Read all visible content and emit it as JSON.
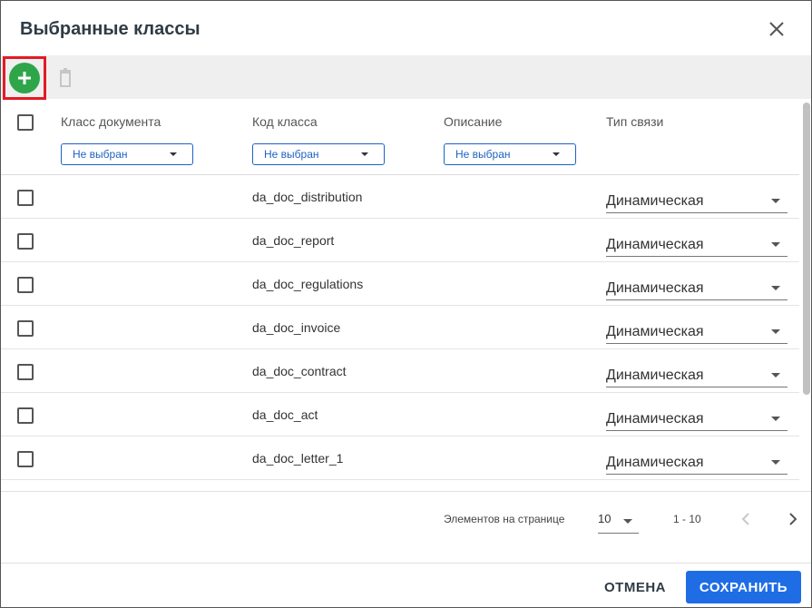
{
  "dialog": {
    "title": "Выбранные классы"
  },
  "table": {
    "columns": [
      {
        "label": "Класс документа",
        "filter": "Не выбран"
      },
      {
        "label": "Код класса",
        "filter": "Не выбран"
      },
      {
        "label": "Описание",
        "filter": "Не выбран"
      },
      {
        "label": "Тип связи"
      }
    ],
    "rows": [
      {
        "doc_class": "",
        "code": "da_doc_distribution",
        "description": "",
        "link_type": "Динамическая"
      },
      {
        "doc_class": "",
        "code": "da_doc_report",
        "description": "",
        "link_type": "Динамическая"
      },
      {
        "doc_class": "",
        "code": "da_doc_regulations",
        "description": "",
        "link_type": "Динамическая"
      },
      {
        "doc_class": "",
        "code": "da_doc_invoice",
        "description": "",
        "link_type": "Динамическая"
      },
      {
        "doc_class": "",
        "code": "da_doc_contract",
        "description": "",
        "link_type": "Динамическая"
      },
      {
        "doc_class": "",
        "code": "da_doc_act",
        "description": "",
        "link_type": "Динамическая"
      },
      {
        "doc_class": "",
        "code": "da_doc_letter_1",
        "description": "",
        "link_type": "Динамическая"
      }
    ]
  },
  "pagination": {
    "per_page_label": "Элементов на странице",
    "per_page_value": "10",
    "range": "1 - 10"
  },
  "actions": {
    "cancel_label": "ОТМЕНА",
    "save_label": "СОХРАНИТЬ"
  },
  "colors": {
    "add_button": "#2fa54a",
    "highlight": "#e31b23",
    "primary": "#1f6de5"
  }
}
